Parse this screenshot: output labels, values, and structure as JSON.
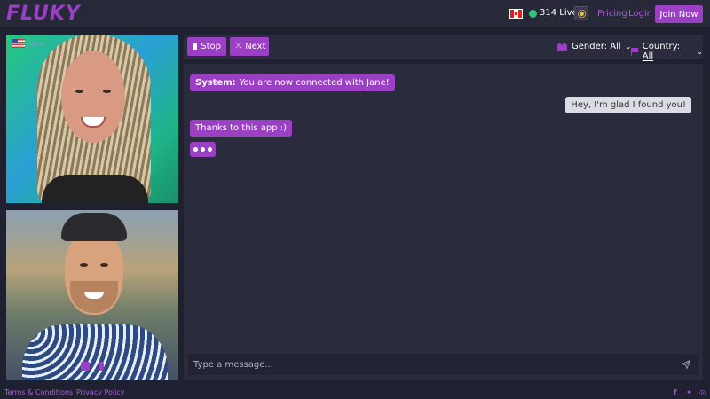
{
  "header": {
    "logo": "FLUKY",
    "live_count": "314 Live",
    "nav": {
      "pricing": "Pricing",
      "login": "Login",
      "join": "Join Now"
    }
  },
  "video": {
    "stranger_name": "Jane"
  },
  "toolbar": {
    "stop_label": "Stop",
    "next_label": "Next",
    "gender_filter": "Gender: All",
    "country_filter": "Country: All"
  },
  "chat": {
    "system_prefix": "System:",
    "system_message": "You are now connected with Jane!",
    "messages": [
      {
        "from": "me",
        "text": "Hey, I'm glad I found you!"
      },
      {
        "from": "stranger",
        "text": "Thanks to this app :)"
      }
    ]
  },
  "input": {
    "placeholder": "Type a message..."
  },
  "footer": {
    "terms": "Terms & Conditions",
    "privacy": "Privacy Policy"
  },
  "icons": {
    "flag_country": "canada-flag-icon",
    "stranger_flag": "usa-flag-icon",
    "report": "flag-icon",
    "send": "paper-plane-icon"
  },
  "colors": {
    "accent": "#9b3fc5",
    "background": "#1f2030",
    "panel": "#2a2b3c",
    "live": "#2ec27e"
  }
}
